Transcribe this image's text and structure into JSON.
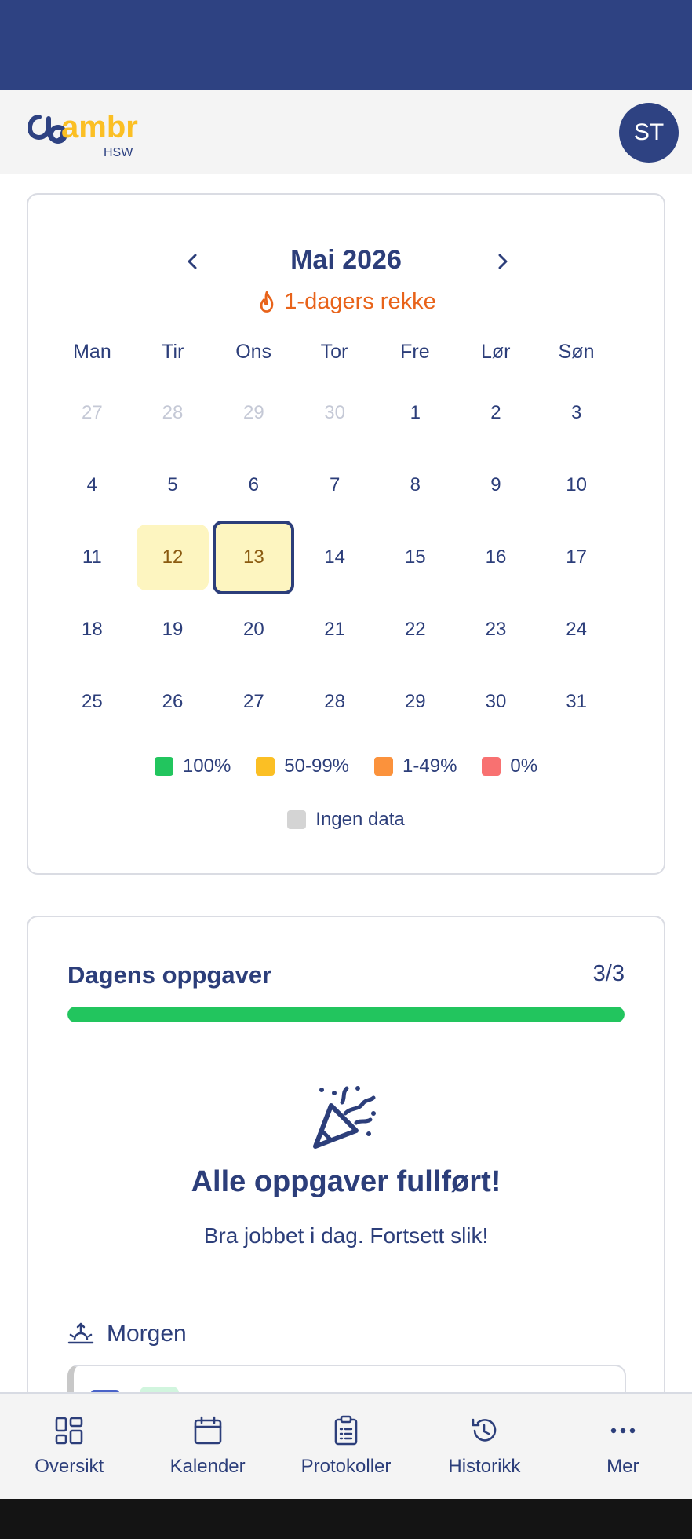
{
  "header": {
    "logo_text": "ambr",
    "logo_sub": "HSW",
    "avatar_initials": "ST"
  },
  "calendar": {
    "month_title": "Mai 2026",
    "streak": "1-dagers rekke",
    "weekdays": [
      "Man",
      "Tir",
      "Ons",
      "Tor",
      "Fre",
      "Lør",
      "Søn"
    ],
    "days": [
      {
        "label": "27",
        "state": "muted"
      },
      {
        "label": "28",
        "state": "muted"
      },
      {
        "label": "29",
        "state": "muted"
      },
      {
        "label": "30",
        "state": "muted"
      },
      {
        "label": "1",
        "state": "normal"
      },
      {
        "label": "2",
        "state": "normal"
      },
      {
        "label": "3",
        "state": "normal"
      },
      {
        "label": "4",
        "state": "normal"
      },
      {
        "label": "5",
        "state": "normal"
      },
      {
        "label": "6",
        "state": "normal"
      },
      {
        "label": "7",
        "state": "normal"
      },
      {
        "label": "8",
        "state": "normal"
      },
      {
        "label": "9",
        "state": "normal"
      },
      {
        "label": "10",
        "state": "normal"
      },
      {
        "label": "11",
        "state": "normal"
      },
      {
        "label": "12",
        "state": "partial"
      },
      {
        "label": "13",
        "state": "today"
      },
      {
        "label": "14",
        "state": "normal"
      },
      {
        "label": "15",
        "state": "normal"
      },
      {
        "label": "16",
        "state": "normal"
      },
      {
        "label": "17",
        "state": "normal"
      },
      {
        "label": "18",
        "state": "normal"
      },
      {
        "label": "19",
        "state": "normal"
      },
      {
        "label": "20",
        "state": "normal"
      },
      {
        "label": "21",
        "state": "normal"
      },
      {
        "label": "22",
        "state": "normal"
      },
      {
        "label": "23",
        "state": "normal"
      },
      {
        "label": "24",
        "state": "normal"
      },
      {
        "label": "25",
        "state": "normal"
      },
      {
        "label": "26",
        "state": "normal"
      },
      {
        "label": "27",
        "state": "normal"
      },
      {
        "label": "28",
        "state": "normal"
      },
      {
        "label": "29",
        "state": "normal"
      },
      {
        "label": "30",
        "state": "normal"
      },
      {
        "label": "31",
        "state": "normal"
      }
    ],
    "legend": [
      {
        "label": "100%",
        "color": "#22c55e"
      },
      {
        "label": "50-99%",
        "color": "#fbbf24"
      },
      {
        "label": "1-49%",
        "color": "#fb923c"
      },
      {
        "label": "0%",
        "color": "#f87171"
      }
    ],
    "legend_nodata": {
      "label": "Ingen data",
      "color": "#d4d4d4"
    }
  },
  "tasks": {
    "title": "Dagens oppgaver",
    "count": "3/3",
    "progress": 1.0,
    "done_title": "Alle oppgaver fullført!",
    "done_sub": "Bra jobbet i dag. Fortsett slik!",
    "section_label": "Morgen"
  },
  "bottom_nav": [
    {
      "label": "Oversikt",
      "icon": "dashboard-icon"
    },
    {
      "label": "Kalender",
      "icon": "calendar-icon"
    },
    {
      "label": "Protokoller",
      "icon": "clipboard-icon"
    },
    {
      "label": "Historikk",
      "icon": "history-icon"
    },
    {
      "label": "Mer",
      "icon": "more-icon"
    }
  ],
  "colors": {
    "primary": "#2e4282",
    "streak": "#e8631a",
    "progress": "#22c55e"
  }
}
